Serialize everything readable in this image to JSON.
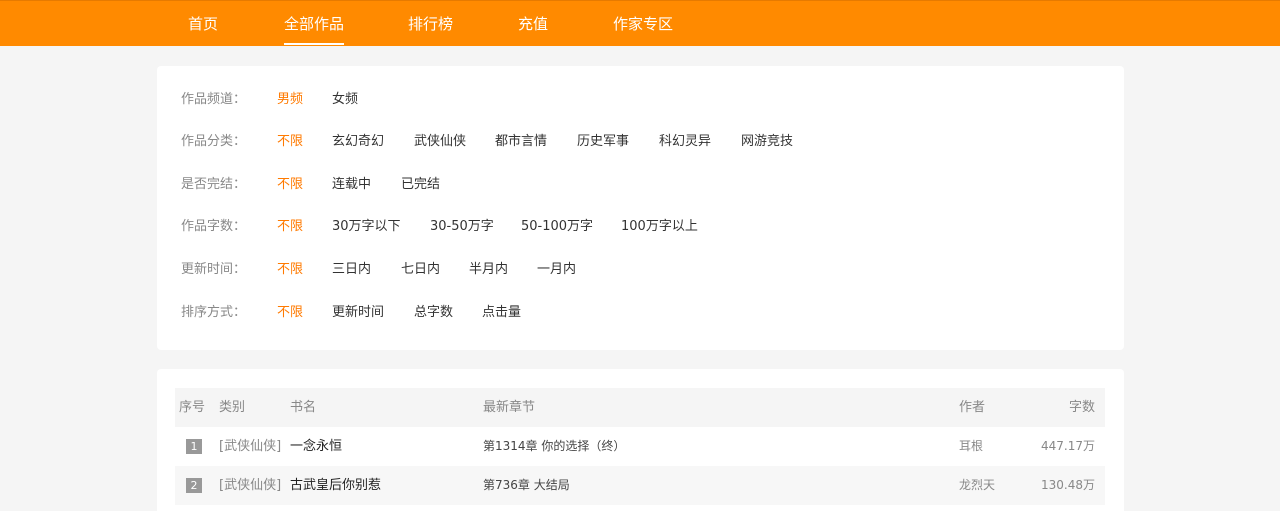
{
  "nav": {
    "items": [
      {
        "label": "首页",
        "active": false
      },
      {
        "label": "全部作品",
        "active": true
      },
      {
        "label": "排行榜",
        "active": false
      },
      {
        "label": "充值",
        "active": false
      },
      {
        "label": "作家专区",
        "active": false
      }
    ]
  },
  "filters": [
    {
      "label": "作品频道：",
      "options": [
        "男频",
        "女频"
      ],
      "selected": 0
    },
    {
      "label": "作品分类：",
      "options": [
        "不限",
        "玄幻奇幻",
        "武侠仙侠",
        "都市言情",
        "历史军事",
        "科幻灵异",
        "网游竞技"
      ],
      "selected": 0
    },
    {
      "label": "是否完结：",
      "options": [
        "不限",
        "连载中",
        "已完结"
      ],
      "selected": 0
    },
    {
      "label": "作品字数：",
      "options": [
        "不限",
        "30万字以下",
        "30-50万字",
        "50-100万字",
        "100万字以上"
      ],
      "selected": 0
    },
    {
      "label": "更新时间：",
      "options": [
        "不限",
        "三日内",
        "七日内",
        "半月内",
        "一月内"
      ],
      "selected": 0
    },
    {
      "label": "排序方式：",
      "options": [
        "不限",
        "更新时间",
        "总字数",
        "点击量"
      ],
      "selected": 0
    }
  ],
  "table": {
    "headers": {
      "rank": "序号",
      "category": "类别",
      "title": "书名",
      "chapter": "最新章节",
      "author": "作者",
      "words": "字数"
    },
    "rows": [
      {
        "rank": "1",
        "category": "[武侠仙侠]",
        "title": "一念永恒",
        "chapter": "第1314章 你的选择（终）",
        "author": "耳根",
        "words": "447.17万"
      },
      {
        "rank": "2",
        "category": "[武侠仙侠]",
        "title": "古武皇后你别惹",
        "chapter": "第736章 大结局",
        "author": "龙烈天",
        "words": "130.48万"
      }
    ]
  },
  "colors": {
    "accent": "#ff8a00",
    "selected": "#ff7a00"
  }
}
